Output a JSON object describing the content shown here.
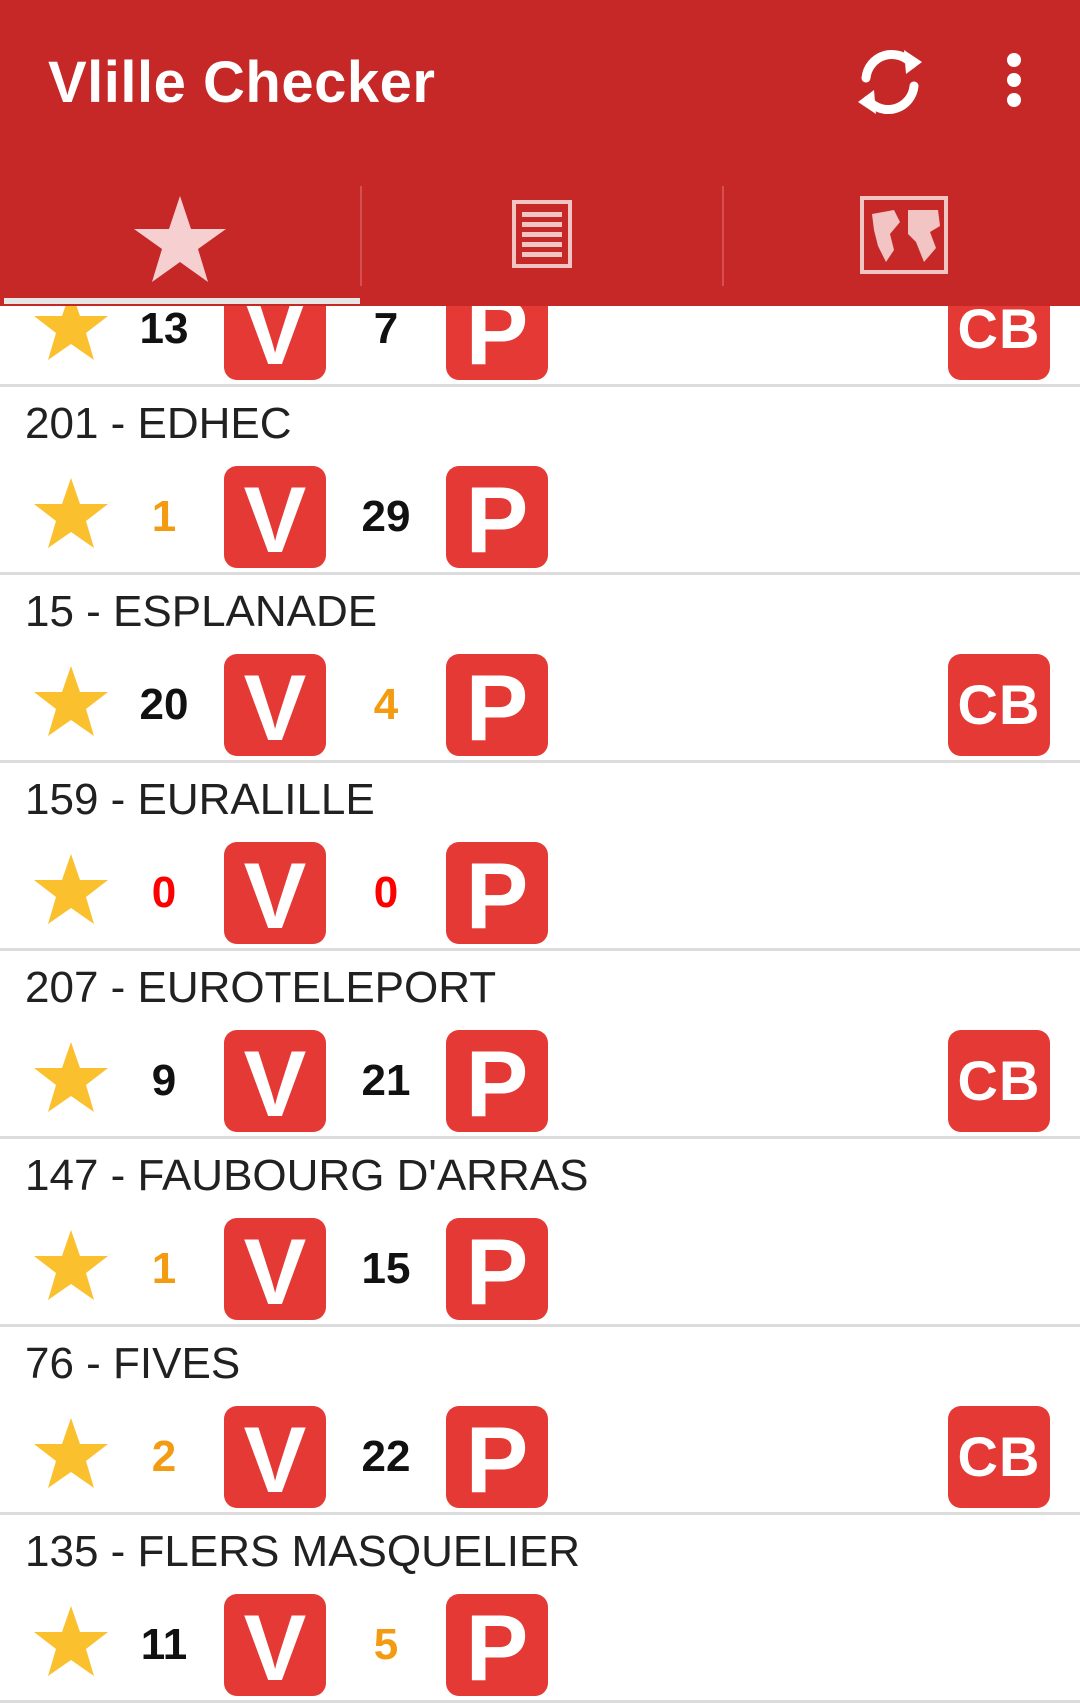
{
  "app": {
    "title": "Vlille Checker",
    "icons": {
      "refresh": "refresh-icon",
      "more": "more-vert-icon"
    }
  },
  "tabs": [
    {
      "name": "favorites",
      "icon": "star-icon",
      "selected": true
    },
    {
      "name": "list",
      "icon": "list-icon",
      "selected": false
    },
    {
      "name": "map",
      "icon": "world-map-icon",
      "selected": false
    }
  ],
  "colors": {
    "primary": "#c62828",
    "badge": "#e53935",
    "star": "#fbc02d",
    "low": "#f39c12",
    "empty": "#ff0000",
    "normal": "#111111"
  },
  "stations": [
    {
      "name": "",
      "bikes": "13",
      "bikes_status": "normal",
      "slots": "7",
      "slots_status": "normal",
      "cb": true
    },
    {
      "name": "201 - EDHEC",
      "bikes": "1",
      "bikes_status": "low",
      "slots": "29",
      "slots_status": "normal",
      "cb": false
    },
    {
      "name": "15 - ESPLANADE",
      "bikes": "20",
      "bikes_status": "normal",
      "slots": "4",
      "slots_status": "low",
      "cb": true
    },
    {
      "name": "159 - EURALILLE",
      "bikes": "0",
      "bikes_status": "empty",
      "slots": "0",
      "slots_status": "empty",
      "cb": false
    },
    {
      "name": "207 - EUROTELEPORT",
      "bikes": "9",
      "bikes_status": "normal",
      "slots": "21",
      "slots_status": "normal",
      "cb": true
    },
    {
      "name": "147 - FAUBOURG D'ARRAS",
      "bikes": "1",
      "bikes_status": "low",
      "slots": "15",
      "slots_status": "normal",
      "cb": false
    },
    {
      "name": "76 - FIVES",
      "bikes": "2",
      "bikes_status": "low",
      "slots": "22",
      "slots_status": "normal",
      "cb": true
    },
    {
      "name": "135 - FLERS MASQUELIER",
      "bikes": "11",
      "bikes_status": "normal",
      "slots": "5",
      "slots_status": "low",
      "cb": false
    }
  ],
  "badges": {
    "bikes": "V",
    "slots": "P",
    "card": "CB"
  }
}
